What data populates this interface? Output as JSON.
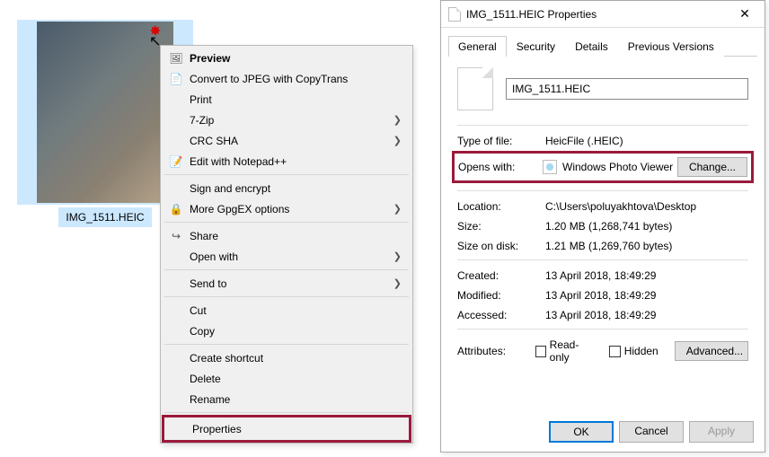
{
  "file": {
    "label": "IMG_1511.HEIC"
  },
  "context_menu": {
    "preview": "Preview",
    "convert": "Convert to JPEG with CopyTrans",
    "print": "Print",
    "seven_zip": "7-Zip",
    "crc_sha": "CRC SHA",
    "edit_npp": "Edit with Notepad++",
    "sign_encrypt": "Sign and encrypt",
    "more_gpgex": "More GpgEX options",
    "share": "Share",
    "open_with": "Open with",
    "send_to": "Send to",
    "cut": "Cut",
    "copy": "Copy",
    "create_shortcut": "Create shortcut",
    "delete": "Delete",
    "rename": "Rename",
    "properties": "Properties"
  },
  "dialog": {
    "title": "IMG_1511.HEIC Properties",
    "tabs": {
      "general": "General",
      "security": "Security",
      "details": "Details",
      "previous": "Previous Versions"
    },
    "filename": "IMG_1511.HEIC",
    "type_lbl": "Type of file:",
    "type_val": "HeicFile (.HEIC)",
    "opens_lbl": "Opens with:",
    "opens_val": "Windows Photo Viewer",
    "change_btn": "Change...",
    "location_lbl": "Location:",
    "location_val": "C:\\Users\\poluyakhtova\\Desktop",
    "size_lbl": "Size:",
    "size_val": "1.20 MB (1,268,741 bytes)",
    "sizeondisk_lbl": "Size on disk:",
    "sizeondisk_val": "1.21 MB (1,269,760 bytes)",
    "created_lbl": "Created:",
    "created_val": "13 April 2018, 18:49:29",
    "modified_lbl": "Modified:",
    "modified_val": "13 April 2018, 18:49:29",
    "accessed_lbl": "Accessed:",
    "accessed_val": "13 April 2018, 18:49:29",
    "attributes_lbl": "Attributes:",
    "readonly": "Read-only",
    "hidden": "Hidden",
    "advanced": "Advanced...",
    "ok": "OK",
    "cancel": "Cancel",
    "apply": "Apply"
  }
}
